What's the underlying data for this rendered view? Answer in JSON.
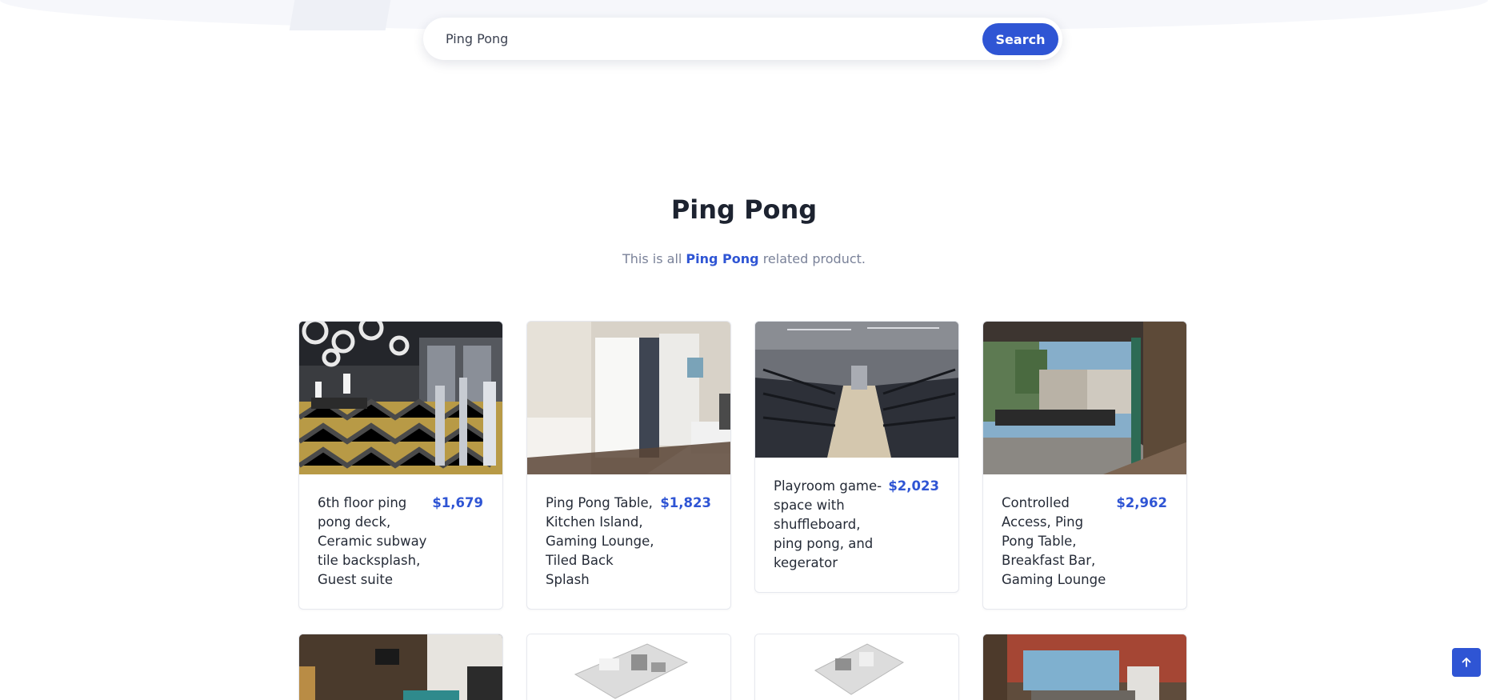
{
  "search": {
    "value": "Ping Pong",
    "button_label": "Search"
  },
  "heading": {
    "title": "Ping Pong",
    "subtitle_prefix": "This is all",
    "subtitle_highlight": "Ping Pong",
    "subtitle_suffix": "related product."
  },
  "products": [
    {
      "title": "6th floor ping pong deck, Ceramic subway tile backsplash, Guest suite",
      "price": "$1,679"
    },
    {
      "title": "Ping Pong Table, Kitchen Island, Gaming Lounge, Tiled Back Splash",
      "price": "$1,823"
    },
    {
      "title": "Playroom game-space with shuffleboard, ping pong, and kegerator",
      "price": "$2,023"
    },
    {
      "title": "Controlled Access, Ping Pong Table, Breakfast Bar, Gaming Lounge",
      "price": "$2,962"
    }
  ],
  "colors": {
    "accent": "#2f55d4",
    "background": "#ffffff",
    "hero_band": "#f6f7fb"
  },
  "icons": {
    "scroll_top": "arrow-up-icon"
  }
}
